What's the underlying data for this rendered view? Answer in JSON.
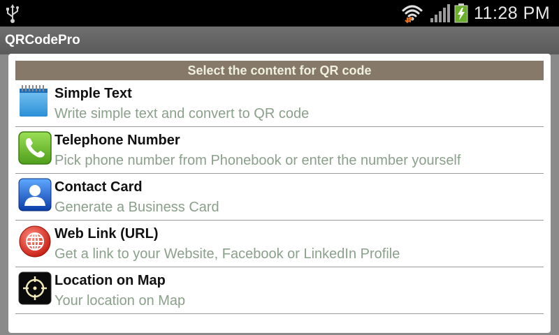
{
  "status_bar": {
    "time": "11:28 PM",
    "icons": [
      "usb-icon",
      "wifi-icon",
      "signal-icon",
      "battery-charging-icon"
    ]
  },
  "app": {
    "title": "QRCodePro"
  },
  "list": {
    "header": "Select the content for QR code",
    "items": [
      {
        "title": "Simple Text",
        "subtitle": "Write simple text and convert to QR code",
        "icon": "notepad-icon"
      },
      {
        "title": "Telephone Number",
        "subtitle": "Pick phone number from Phonebook or enter the number yourself",
        "icon": "phone-icon"
      },
      {
        "title": "Contact Card",
        "subtitle": "Generate a Business Card",
        "icon": "contact-card-icon"
      },
      {
        "title": "Web Link (URL)",
        "subtitle": "Get a link to your Website, Facebook or LinkedIn Profile",
        "icon": "globe-icon"
      },
      {
        "title": "Location on Map",
        "subtitle": "Your location on Map",
        "icon": "map-target-icon"
      }
    ]
  },
  "colors": {
    "header_bg": "#86796a",
    "subtitle": "#8aa08a",
    "title_bar": "#5f5f5f"
  }
}
